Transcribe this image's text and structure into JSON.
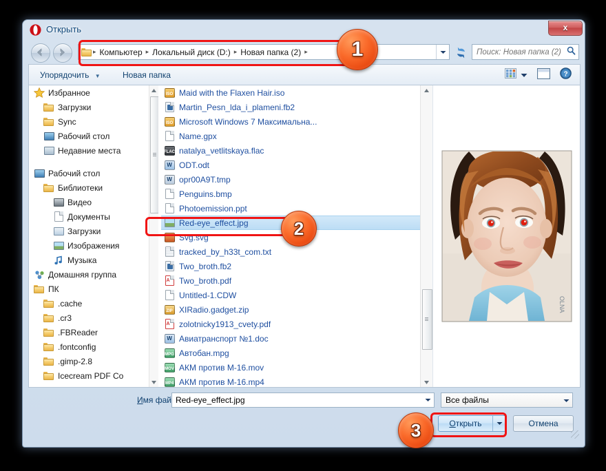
{
  "window": {
    "title": "Открыть",
    "logo_icon": "opera-logo-icon",
    "close_label": "x"
  },
  "nav": {
    "back_icon": "back-arrow-icon",
    "forward_icon": "forward-arrow-icon",
    "folder_icon": "folder-icon",
    "dropdown_icon": "chevron-down-icon",
    "refresh_icon": "refresh-icon",
    "breadcrumbs": [
      "Компьютер",
      "Локальный диск (D:)",
      "Новая папка (2)"
    ],
    "separator": "▸"
  },
  "search": {
    "placeholder": "Поиск: Новая папка (2)",
    "icon": "search-icon"
  },
  "toolbar": {
    "organize_label": "Упорядочить",
    "organize_caret": "▼",
    "new_folder_label": "Новая папка",
    "view_icon": "view-grid-icon",
    "view_caret_icon": "chevron-down-icon",
    "preview_pane_icon": "preview-pane-icon",
    "help_icon": "help-icon"
  },
  "sidebar": {
    "items": [
      {
        "label": "Избранное",
        "icon": "star-icon",
        "indent": 0
      },
      {
        "label": "Загрузки",
        "icon": "folder-download-icon",
        "indent": 1
      },
      {
        "label": "Sync",
        "icon": "folder-icon",
        "indent": 1
      },
      {
        "label": "Рабочий стол",
        "icon": "desktop-icon",
        "indent": 1
      },
      {
        "label": "Недавние места",
        "icon": "recent-places-icon",
        "indent": 1
      },
      {
        "label": "",
        "icon": "spacer",
        "indent": 0
      },
      {
        "label": "Рабочий стол",
        "icon": "desktop-icon",
        "indent": 0
      },
      {
        "label": "Библиотеки",
        "icon": "libraries-icon",
        "indent": 1
      },
      {
        "label": "Видео",
        "icon": "video-icon",
        "indent": 2
      },
      {
        "label": "Документы",
        "icon": "documents-icon",
        "indent": 2
      },
      {
        "label": "Загрузки",
        "icon": "downloads-library-icon",
        "indent": 2
      },
      {
        "label": "Изображения",
        "icon": "pictures-icon",
        "indent": 2
      },
      {
        "label": "Музыка",
        "icon": "music-icon",
        "indent": 2
      },
      {
        "label": "Домашняя группа",
        "icon": "homegroup-icon",
        "indent": 0
      },
      {
        "label": "ПК",
        "icon": "user-folder-icon",
        "indent": 0
      },
      {
        "label": ".cache",
        "icon": "folder-icon",
        "indent": 1
      },
      {
        "label": ".cr3",
        "icon": "folder-icon",
        "indent": 1
      },
      {
        "label": ".FBReader",
        "icon": "folder-icon",
        "indent": 1
      },
      {
        "label": ".fontconfig",
        "icon": "folder-icon",
        "indent": 1
      },
      {
        "label": ".gimp-2.8",
        "icon": "folder-icon",
        "indent": 1
      },
      {
        "label": "Icecream PDF Co",
        "icon": "folder-icon",
        "indent": 1
      }
    ],
    "scrollbar": {
      "up_icon": "scroll-up-icon",
      "down_icon": "scroll-down-icon"
    }
  },
  "filelist": {
    "selected": "Red-eye_effect.jpg",
    "items": [
      {
        "name": "Maid with the Flaxen Hair.iso",
        "icon": "iso-file-icon",
        "kind": "iso"
      },
      {
        "name": "Martin_Pesn_lda_i_plameni.fb2",
        "icon": "fb2-file-icon",
        "kind": "fb2"
      },
      {
        "name": "Microsoft Windows 7 Максимальна...",
        "icon": "iso-file-icon",
        "kind": "iso"
      },
      {
        "name": "Name.gpx",
        "icon": "generic-file-icon",
        "kind": "blank"
      },
      {
        "name": "natalya_vetlitskaya.flac",
        "icon": "flac-file-icon",
        "kind": "flac"
      },
      {
        "name": "ODT.odt",
        "icon": "word-file-icon",
        "kind": "word"
      },
      {
        "name": "opr00A9T.tmp",
        "icon": "word-file-icon",
        "kind": "wordsm"
      },
      {
        "name": "Penguins.bmp",
        "icon": "generic-file-icon",
        "kind": "blank"
      },
      {
        "name": "Photoemission.ppt",
        "icon": "generic-file-icon",
        "kind": "blank"
      },
      {
        "name": "Red-eye_effect.jpg",
        "icon": "image-file-icon",
        "kind": "image"
      },
      {
        "name": "Svg.svg",
        "icon": "svg-file-icon",
        "kind": "svg"
      },
      {
        "name": "tracked_by_h33t_com.txt",
        "icon": "text-file-icon",
        "kind": "text"
      },
      {
        "name": "Two_broth.fb2",
        "icon": "fb2-file-icon",
        "kind": "fb2"
      },
      {
        "name": "Two_broth.pdf",
        "icon": "pdf-file-icon",
        "kind": "pdf"
      },
      {
        "name": "Untitled-1.CDW",
        "icon": "generic-file-icon",
        "kind": "blank"
      },
      {
        "name": "XIRadio.gadget.zip",
        "icon": "zip-file-icon",
        "kind": "zip"
      },
      {
        "name": "zolotnicky1913_cvety.pdf",
        "icon": "pdf-file-icon",
        "kind": "pdf"
      },
      {
        "name": "Авиатранспорт №1.doc",
        "icon": "word-file-icon",
        "kind": "word"
      },
      {
        "name": "Автобан.mpg",
        "icon": "mpg-file-icon",
        "kind": "mpg"
      },
      {
        "name": "АКМ против М-16.mov",
        "icon": "mov-file-icon",
        "kind": "mov"
      },
      {
        "name": "АКМ против М-16.mp4",
        "icon": "mp4-file-icon",
        "kind": "mp4"
      }
    ],
    "scrollbar": {
      "up_icon": "scroll-up-icon",
      "down_icon": "scroll-down-icon"
    }
  },
  "preview": {
    "description": "Red-eye_effect.jpg",
    "alt": "portrait-photo-with-red-eye"
  },
  "footer": {
    "filename_label": "Имя файла:",
    "filename_value": "Red-eye_effect.jpg",
    "filename_dropdown_icon": "chevron-down-icon",
    "filter_value": "Все файлы",
    "filter_dropdown_icon": "chevron-down-icon",
    "open_label": "Открыть",
    "open_split_icon": "chevron-down-icon",
    "cancel_label": "Отмена"
  },
  "annotations": {
    "badges": [
      {
        "number": "1",
        "target": "address-bar"
      },
      {
        "number": "2",
        "target": "selected-file"
      },
      {
        "number": "3",
        "target": "open-button"
      }
    ],
    "highlight_color": "#f01414",
    "badge_color": "#fa6a2a"
  }
}
